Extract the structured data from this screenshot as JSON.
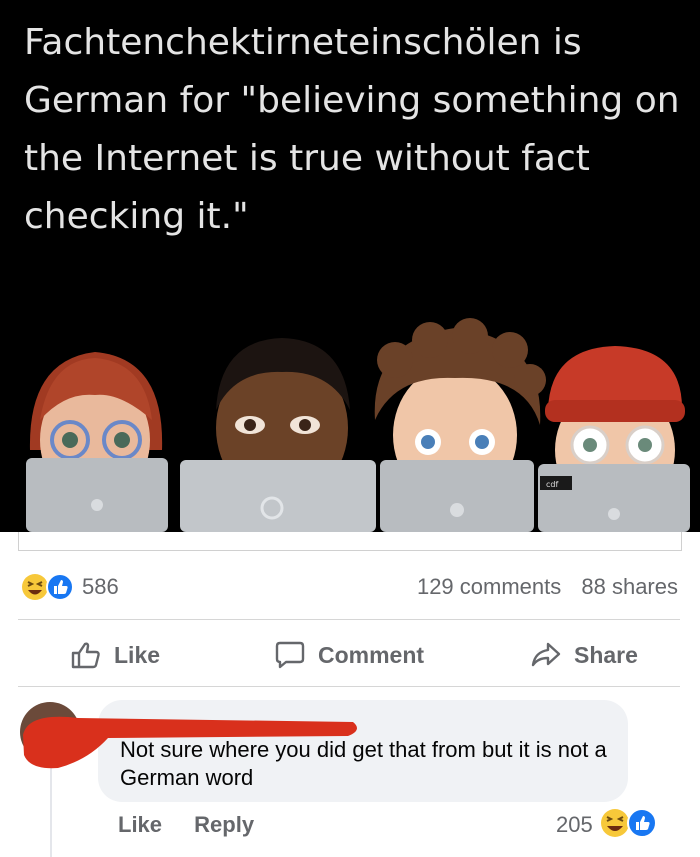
{
  "post": {
    "image_text": "Fachtenchektirneteinschölen is German for \"believing something on the Internet is true without fact checking it.\"",
    "laptop_sticker": "cdf"
  },
  "stats": {
    "reaction_count": "586",
    "comments": "129 comments",
    "shares": "88 shares",
    "reactions": [
      "haha-icon",
      "like-icon"
    ]
  },
  "actions": {
    "like": "Like",
    "comment": "Comment",
    "share": "Share"
  },
  "comment": {
    "text": "Not sure where you did get that from but it is not a German word",
    "like": "Like",
    "reply": "Reply",
    "reaction_count": "205"
  },
  "colors": {
    "background": "#ffffff",
    "image_background": "#000000",
    "meta_text": "#65676b",
    "bubble": "#f0f2f5",
    "like_blue": "#1877f2",
    "haha_yellow": "#f7c83a",
    "redaction": "#d9301c"
  }
}
